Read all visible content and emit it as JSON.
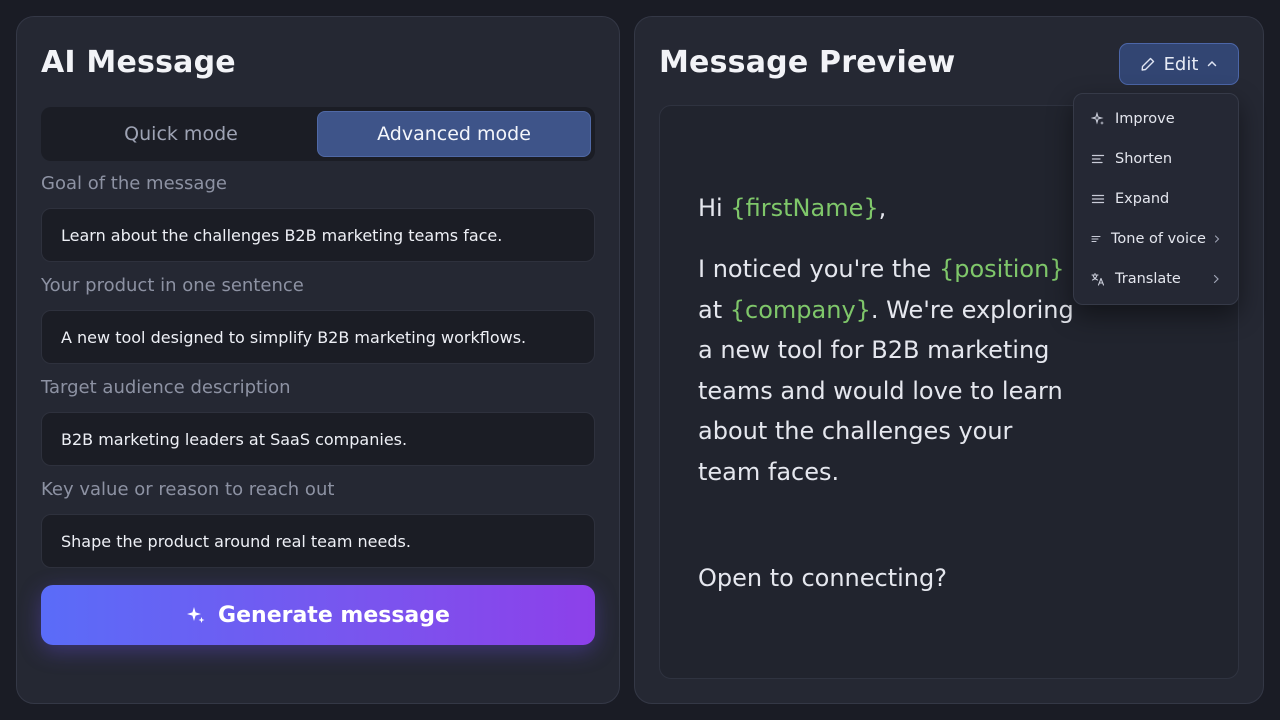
{
  "left": {
    "title": "AI Message",
    "modes": {
      "quick": "Quick mode",
      "advanced": "Advanced mode",
      "active": "advanced"
    },
    "fields": [
      {
        "label": "Goal of the message",
        "value": "Learn about the challenges B2B marketing teams face."
      },
      {
        "label": "Your product in one sentence",
        "value": "A new tool designed to simplify B2B marketing workflows."
      },
      {
        "label": "Target audience description",
        "value": "B2B marketing leaders at SaaS companies."
      },
      {
        "label": "Key value or reason to reach out",
        "value": "Shape the product around real team needs."
      }
    ],
    "generate_label": "Generate message"
  },
  "right": {
    "title": "Message Preview",
    "edit_label": "Edit",
    "message": {
      "greeting": "Hi",
      "first_name_var": "{firstName}",
      "greeting_punct": ",",
      "p1_intro": "I noticed you're the",
      "position_var": "{position}",
      "at": "at",
      "company_var": "{company}",
      "p1_rest": ". We're exploring a new tool for B2B marketing teams and would love to learn about the challenges your team faces.",
      "closing": "Open to connecting?"
    },
    "edit_menu": [
      {
        "label": "Improve",
        "icon": "sparkle-icon"
      },
      {
        "label": "Shorten",
        "icon": "shorten-icon"
      },
      {
        "label": "Expand",
        "icon": "expand-icon"
      },
      {
        "label": "Tone of voice",
        "icon": "tone-icon",
        "submenu": true
      },
      {
        "label": "Translate",
        "icon": "translate-icon",
        "submenu": true
      }
    ]
  },
  "colors": {
    "accent_blue": "#3e5489",
    "variable_green": "#7fc76a",
    "gradient_start": "#5a6cf8",
    "gradient_end": "#8d40ea"
  }
}
